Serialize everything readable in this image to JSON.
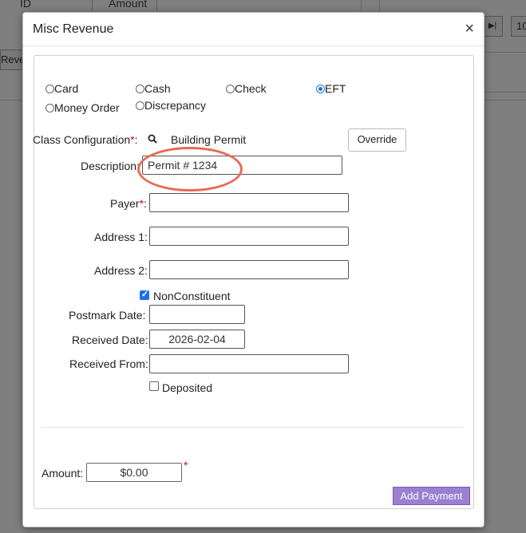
{
  "background": {
    "col_id": "ID",
    "col_amount": "Amount",
    "left_btn": "Reven",
    "right_btn_glyph": "▶|",
    "right_input": "10"
  },
  "modal": {
    "title": "Misc Revenue",
    "close_glyph": "×"
  },
  "payment_types": [
    {
      "label": "Card",
      "selected": false
    },
    {
      "label": "Cash",
      "selected": false
    },
    {
      "label": "Check",
      "selected": false
    },
    {
      "label": "EFT",
      "selected": true
    },
    {
      "label": "Money Order",
      "selected": false
    },
    {
      "label": "Discrepancy",
      "selected": false
    }
  ],
  "form": {
    "class_config_label": "Class Configuration",
    "required_mark": "*",
    "colon": ":",
    "class_config_value": "Building Permit",
    "override_label": "Override",
    "description_label": "Description:",
    "description_value": "Permit # 1234",
    "payer_label": "Payer",
    "address1_label": "Address 1:",
    "address2_label": "Address 2:",
    "nonconstituent_label": "NonConstituent",
    "nonconstituent_checked": true,
    "postmark_label": "Postmark Date:",
    "received_date_label": "Received Date:",
    "received_date_value": "2026-02-04",
    "received_from_label": "Received From:",
    "deposited_label": "Deposited",
    "deposited_checked": false,
    "amount_label": "Amount:",
    "amount_value": "$0.00",
    "add_payment_label": "Add Payment"
  },
  "colors": {
    "accent": "#1a73e8",
    "add_payment_bg": "#9b7fd1",
    "annotation": "#e86a57",
    "required": "#d9001b"
  }
}
